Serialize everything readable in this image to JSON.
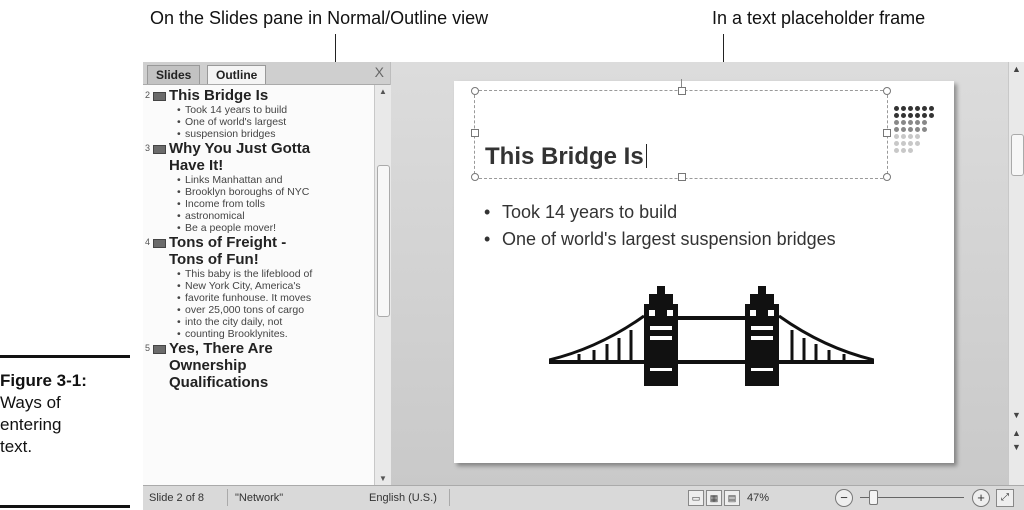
{
  "callouts": {
    "left": "On the Slides pane in Normal/Outline view",
    "right": "In a text placeholder frame"
  },
  "caption": {
    "label": "Figure 3-1:",
    "line1": "Ways of",
    "line2": "entering",
    "line3": "text."
  },
  "tabs": {
    "slides": "Slides",
    "outline": "Outline",
    "close": "X"
  },
  "outline": [
    {
      "num": "2",
      "title": "This Bridge Is",
      "bullets": [
        "Took 14 years to build",
        "One of world's largest",
        "suspension bridges"
      ]
    },
    {
      "num": "3",
      "title": "Why You Just Gotta",
      "title2": "Have It!",
      "bullets": [
        "Links Manhattan and",
        "Brooklyn boroughs of NYC",
        "Income from  tolls",
        "astronomical",
        "Be a people mover!"
      ]
    },
    {
      "num": "4",
      "title": "Tons of Freight -",
      "title2": "Tons of Fun!",
      "bullets": [
        "This baby is the lifeblood of",
        "New York City, America's",
        "favorite funhouse. It moves",
        "over 25,000 tons of cargo",
        "into the city daily, not",
        "counting Brooklynites."
      ]
    },
    {
      "num": "5",
      "title": "Yes, There Are",
      "title2": "Ownership",
      "title3": "Qualifications"
    }
  ],
  "slide": {
    "title": "This Bridge Is",
    "bullets": [
      "Took 14 years to build",
      "One of world's largest suspension bridges"
    ]
  },
  "status": {
    "slide_pos": "Slide 2 of 8",
    "theme": "\"Network\"",
    "language": "English (U.S.)",
    "zoom": "47%",
    "zoom_minus": "−",
    "zoom_plus": "+"
  },
  "colors": {
    "dot_dark": "#333333",
    "dot_mid": "#888888",
    "dot_light": "#c8c8c8"
  }
}
